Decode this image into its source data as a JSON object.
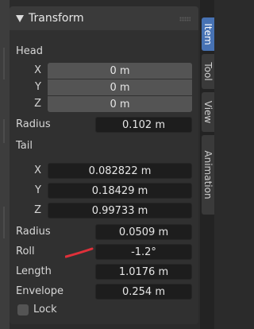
{
  "panel": {
    "title": "Transform",
    "head": {
      "label": "Head",
      "x_label": "X",
      "x": "0 m",
      "y_label": "Y",
      "y": "0 m",
      "z_label": "Z",
      "z": "0 m",
      "radius_label": "Radius",
      "radius": "0.102 m"
    },
    "tail": {
      "label": "Tail",
      "x_label": "X",
      "x": "0.082822 m",
      "y_label": "Y",
      "y": "0.18429 m",
      "z_label": "Z",
      "z": "0.99733 m",
      "radius_label": "Radius",
      "radius": "0.0509 m"
    },
    "roll_label": "Roll",
    "roll": "-1.2°",
    "length_label": "Length",
    "length": "1.0176 m",
    "envelope_label": "Envelope",
    "envelope": "0.254 m",
    "lock_label": "Lock"
  },
  "tabs": [
    "Item",
    "Tool",
    "View",
    "Animation"
  ],
  "colors": {
    "active_tab": "#4772b3",
    "annotation": "#e0303a",
    "field": "#545454",
    "field_dark": "#1d1d1d"
  }
}
